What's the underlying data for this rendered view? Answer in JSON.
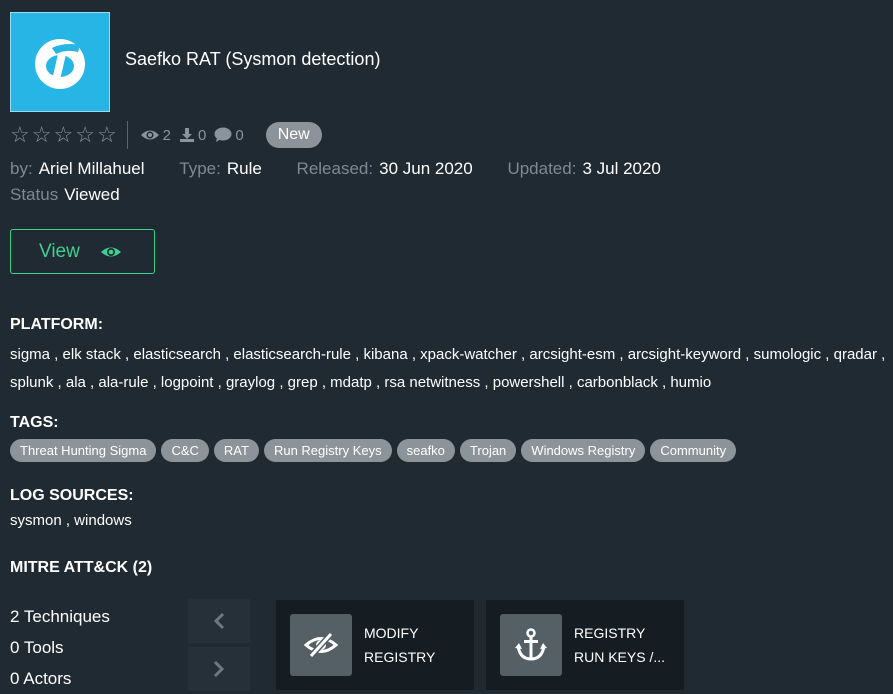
{
  "item": {
    "title": "Saefko RAT (Sysmon detection)",
    "views": "2",
    "downloads": "0",
    "comments": "0",
    "badge": "New"
  },
  "info": {
    "by_label": "by:",
    "by_value": "Ariel Millahuel",
    "type_label": "Type:",
    "type_value": "Rule",
    "released_label": "Released:",
    "released_value": "30 Jun 2020",
    "updated_label": "Updated:",
    "updated_value": "3 Jul 2020",
    "status_label": "Status",
    "status_value": "Viewed"
  },
  "view_button": {
    "label": "View"
  },
  "platform": {
    "heading": "PLATFORM:",
    "text": "sigma , elk stack , elasticsearch , elasticsearch-rule , kibana , xpack-watcher , arcsight-esm , arcsight-keyword , sumologic , qradar , splunk , ala , ala-rule , logpoint , graylog , grep , mdatp , rsa netwitness , powershell , carbonblack , humio"
  },
  "tags": {
    "heading": "TAGS:",
    "items": [
      "Threat Hunting Sigma",
      "C&C",
      "RAT",
      "Run Registry Keys",
      "seafko",
      "Trojan",
      "Windows Registry",
      "Community"
    ]
  },
  "log_sources": {
    "heading": "LOG SOURCES:",
    "text": "sysmon , windows"
  },
  "mitre": {
    "heading": "MITRE ATT&CK (2)",
    "techniques": "2 Techniques",
    "tools": "0 Tools",
    "actors": "0 Actors",
    "cards": [
      {
        "line1": "MODIFY",
        "line2": "REGISTRY",
        "icon": "eye-slash-icon"
      },
      {
        "line1": "REGISTRY",
        "line2": "RUN KEYS /...",
        "icon": "anchor-icon"
      }
    ]
  },
  "colors": {
    "background": "#1f2a33",
    "accent": "#3fcf8e",
    "logo_bg": "#27b5e6",
    "tag_bg": "#8d9499"
  }
}
